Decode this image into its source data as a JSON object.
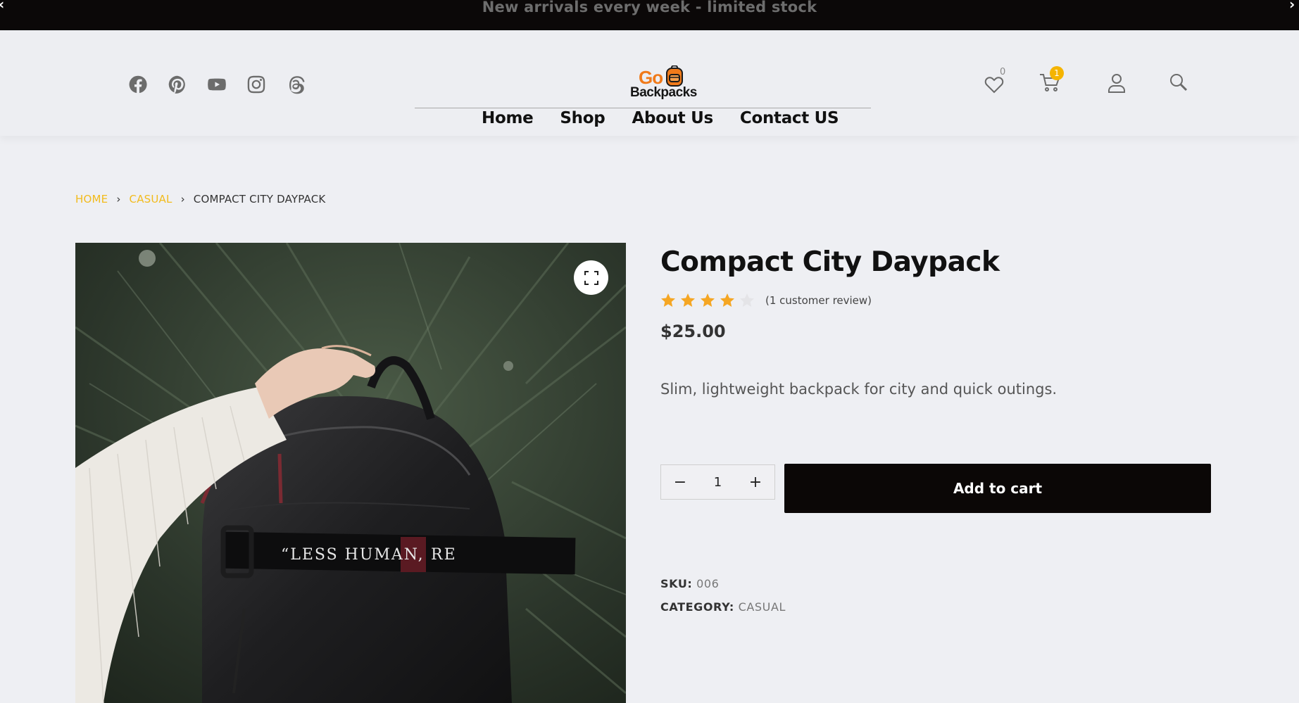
{
  "announcement": {
    "text": "New arrivals every week - limited stock",
    "prev_icon": "chevron-left-icon",
    "next_icon": "chevron-right-icon"
  },
  "header": {
    "socials": [
      "facebook-icon",
      "pinterest-icon",
      "youtube-icon",
      "instagram-icon",
      "threads-icon"
    ],
    "logo": {
      "top": "Go",
      "bottom": "Backpacks"
    },
    "nav": [
      "Home",
      "Shop",
      "About Us",
      "Contact US"
    ],
    "wishlist_count": "0",
    "cart_count": "1"
  },
  "breadcrumb": {
    "home": "HOME",
    "category": "CASUAL",
    "current": "COMPACT CITY DAYPACK"
  },
  "product": {
    "title": "Compact City Daypack",
    "rating": 4,
    "rating_max": 5,
    "review_text": "(1 customer review)",
    "price": "$25.00",
    "description": "Slim, lightweight backpack for city and quick outings.",
    "quantity": "1",
    "add_to_cart": "Add to cart",
    "strap_text": "“LESS HUMAN,",
    "strap_text_end": "RE",
    "sku_label": "SKU:",
    "sku": "006",
    "category_label": "CATEGORY:",
    "category": "CASUAL"
  },
  "colors": {
    "accent": "#f2bb1c",
    "star": "#f5a623",
    "dark": "#0b0706",
    "badge": "#f5b400"
  }
}
